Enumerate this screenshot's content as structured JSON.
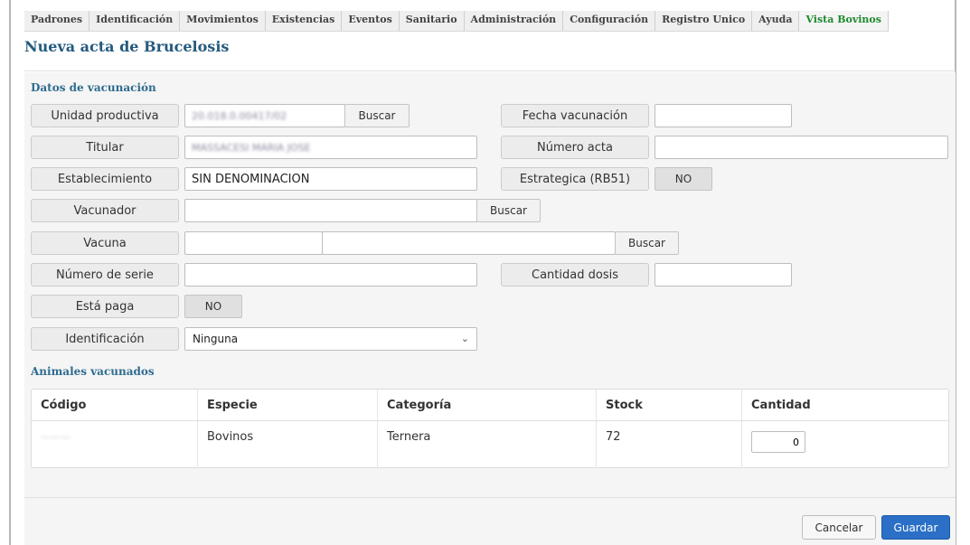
{
  "menu": {
    "items": [
      "Padrones",
      "Identificación",
      "Movimientos",
      "Existencias",
      "Eventos",
      "Sanitario",
      "Administración",
      "Configuración",
      "Registro Unico",
      "Ayuda"
    ],
    "active": "Vista Bovinos"
  },
  "page": {
    "title": "Nueva acta de Brucelosis"
  },
  "vacunacion": {
    "section_title": "Datos de vacunación",
    "unidad_label": "Unidad productiva",
    "unidad_value": "20.018.0.00417/02",
    "buscar": "Buscar",
    "fecha_label": "Fecha vacunación",
    "fecha_value": "",
    "titular_label": "Titular",
    "titular_value": "MASSACESI MARIA JOSE",
    "numero_acta_label": "Número acta",
    "numero_acta_value": "",
    "establecimiento_label": "Establecimiento",
    "establecimiento_value": "SIN DENOMINACION",
    "estrategica_label": "Estrategica (RB51)",
    "estrategica_value": "NO",
    "vacunador_label": "Vacunador",
    "vacuna_label": "Vacuna",
    "numero_serie_label": "Número de serie",
    "cantidad_dosis_label": "Cantidad dosis",
    "esta_paga_label": "Está paga",
    "esta_paga_value": "NO",
    "identificacion_label": "Identificación",
    "identificacion_value": "Ninguna"
  },
  "animales": {
    "section_title": "Animales vacunados",
    "columns": [
      "Código",
      "Especie",
      "Categoría",
      "Stock",
      "Cantidad"
    ],
    "rows": [
      {
        "codigo": "———",
        "especie": "Bovinos",
        "categoria": "Ternera",
        "stock": "72",
        "cantidad": "0"
      }
    ]
  },
  "actions": {
    "cancel": "Cancelar",
    "save": "Guardar"
  },
  "colors": {
    "accent": "#2b70c6",
    "title": "#245a7e",
    "active_menu": "#1e8a2f"
  }
}
